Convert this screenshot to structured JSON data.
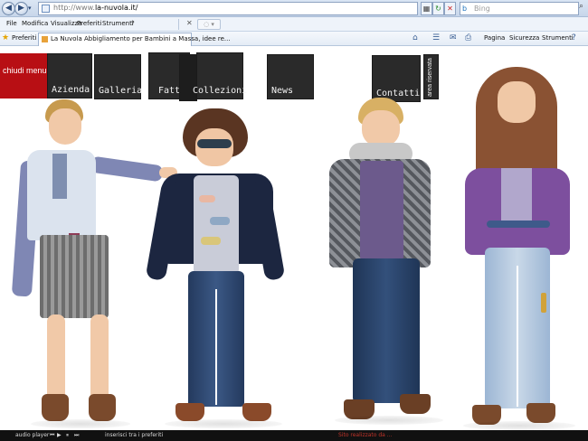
{
  "browser": {
    "address_prefix": "http://www.",
    "address_domain": "la-nuvola.it/",
    "search_placeholder": "Bing",
    "menu": [
      "File",
      "Modifica",
      "Visualizza",
      "Preferiti",
      "Strumenti",
      "?"
    ],
    "favorites_label": "Preferiti",
    "tab_title": "La Nuvola Abbigliamento per Bambini a Massa, idee re...",
    "commands": {
      "page": "Pagina",
      "security": "Sicurezza",
      "tools": "Strumenti"
    }
  },
  "site_nav": {
    "close_menu": "chiudi menu",
    "items": [
      "Azienda",
      "Galleria",
      "Fatti I",
      "Collezioni",
      "News",
      "Contatti"
    ],
    "reserved_area": "area riservata"
  },
  "statusbar": {
    "audio_player": "audio player",
    "add_favorites": "inserisci tra i preferiti",
    "credit": "Sito realizzato da ..."
  },
  "colors": {
    "nav_box": "#2a2a2a",
    "close_menu": "#b80f14",
    "statusbar": "#111111"
  }
}
